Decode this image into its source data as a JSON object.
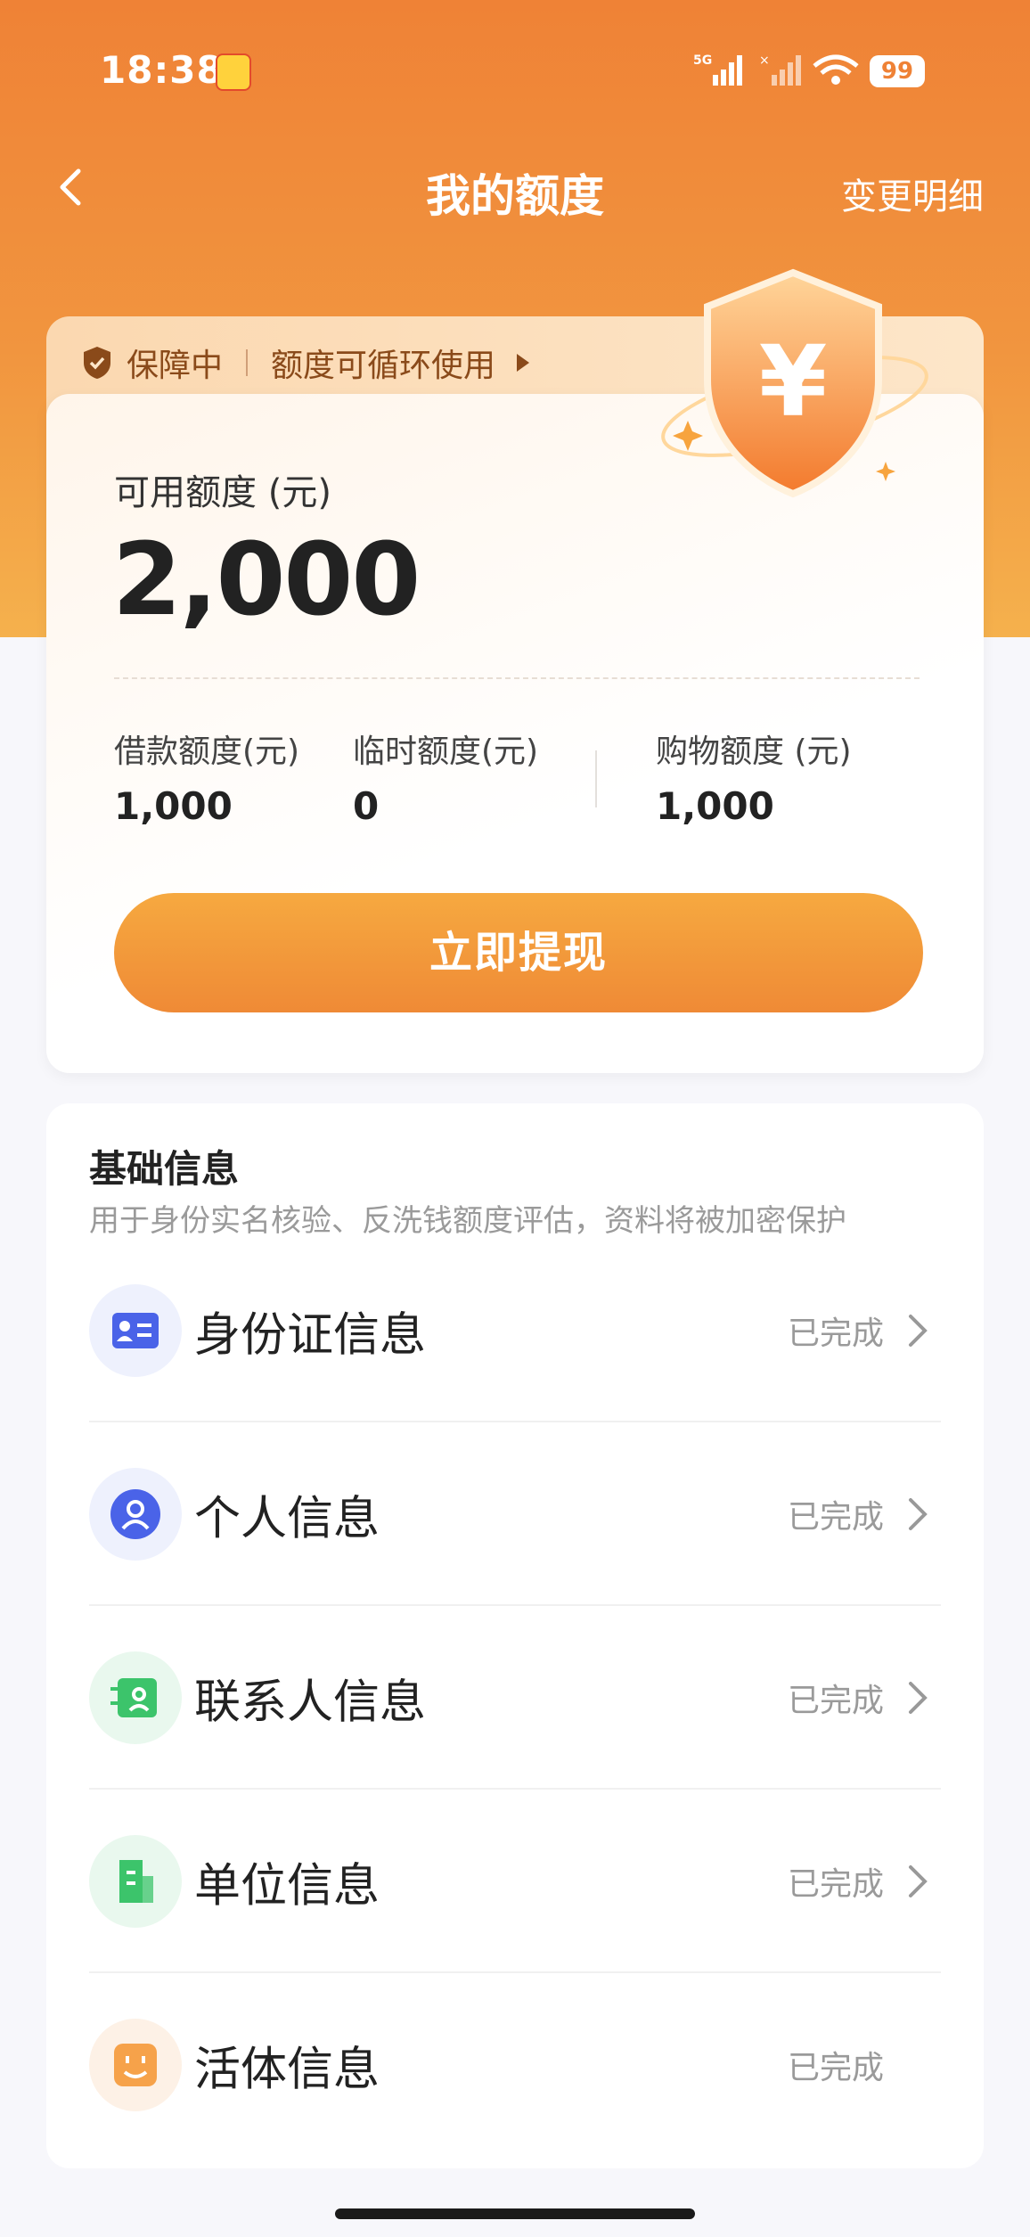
{
  "status": {
    "time": "18:38",
    "battery": "99",
    "network": "5G"
  },
  "nav": {
    "title": "我的额度",
    "right_action": "变更明细"
  },
  "guard": {
    "status": "保障中",
    "note": "额度可循环使用"
  },
  "card": {
    "available_label": "可用额度 (元)",
    "available_amount": "2,000",
    "sub_items": [
      {
        "label": "借款额度(元)",
        "value": "1,000"
      },
      {
        "label": "临时额度(元)",
        "value": "0"
      },
      {
        "label": "购物额度 (元)",
        "value": "1,000"
      }
    ],
    "cta": "立即提现"
  },
  "info": {
    "title": "基础信息",
    "description": "用于身份实名核验、反洗钱额度评估，资料将被加密保护",
    "rows": [
      {
        "label": "身份证信息",
        "status": "已完成",
        "icon": "id-card-icon"
      },
      {
        "label": "个人信息",
        "status": "已完成",
        "icon": "person-icon"
      },
      {
        "label": "联系人信息",
        "status": "已完成",
        "icon": "contacts-icon"
      },
      {
        "label": "单位信息",
        "status": "已完成",
        "icon": "building-icon"
      },
      {
        "label": "活体信息",
        "status": "已完成",
        "icon": "face-icon"
      }
    ]
  },
  "colors": {
    "primary": "#ef8236",
    "accent_light": "#f5b14d",
    "button": "#ef8a36"
  }
}
